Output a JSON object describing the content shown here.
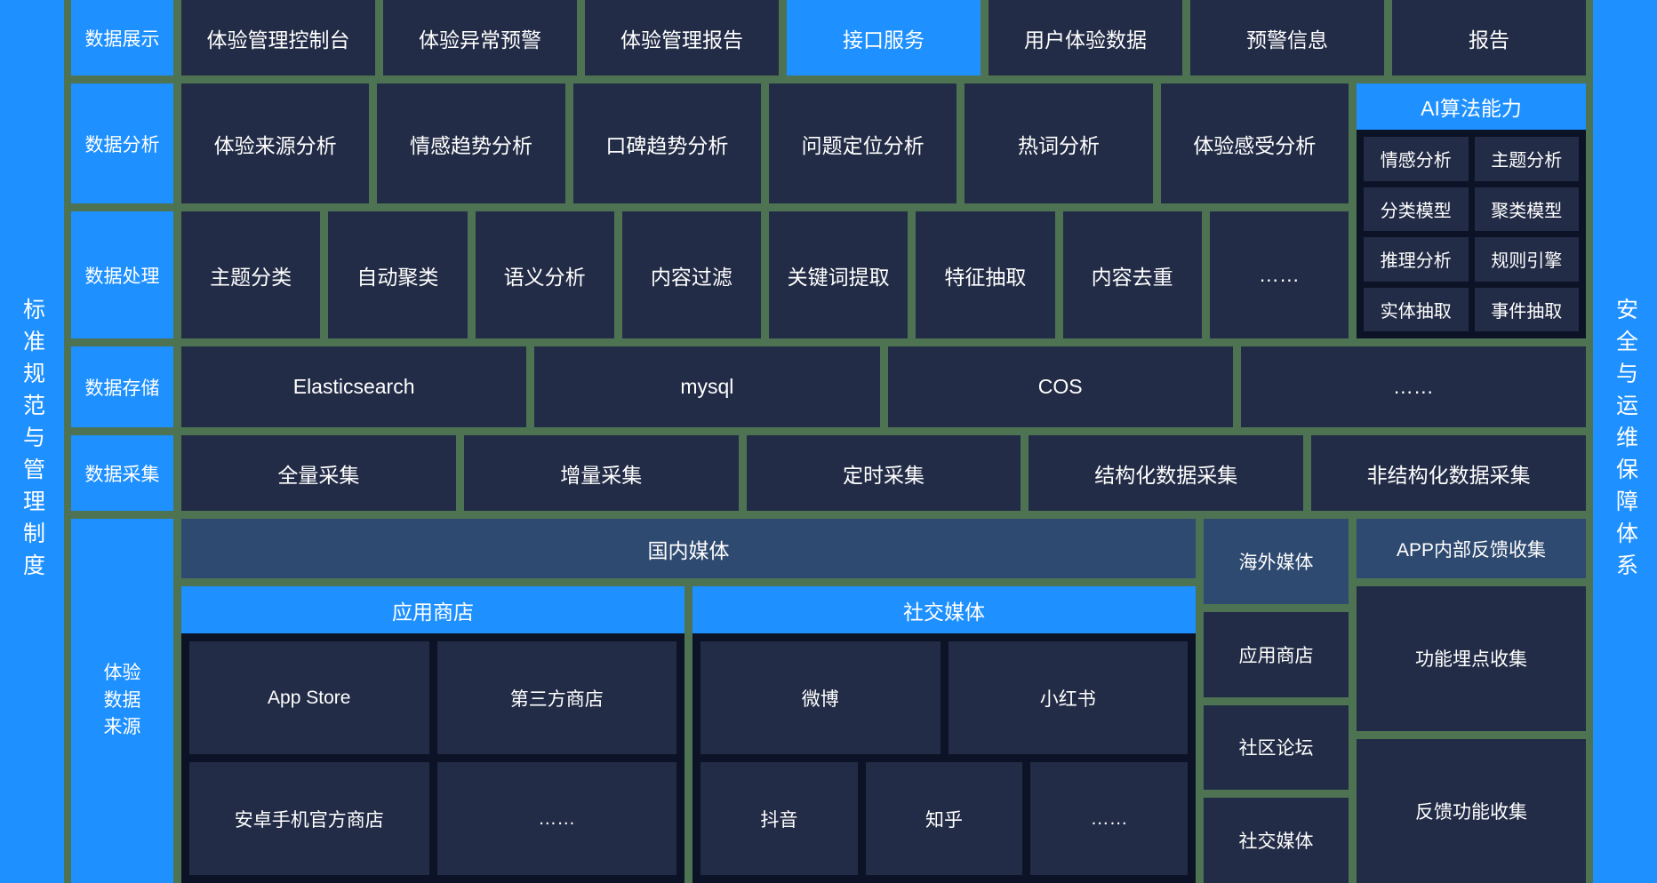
{
  "left_pillar": {
    "label": "标准规范与管理制度"
  },
  "right_pillar": {
    "label": "安全与运维保障体系"
  },
  "rows": {
    "display": {
      "label": "数据展示",
      "items": [
        {
          "text": "体验管理控制台",
          "style": "dark"
        },
        {
          "text": "体验异常预警",
          "style": "dark"
        },
        {
          "text": "体验管理报告",
          "style": "dark"
        },
        {
          "text": "接口服务",
          "style": "blue"
        },
        {
          "text": "用户体验数据",
          "style": "dark"
        },
        {
          "text": "预警信息",
          "style": "dark"
        },
        {
          "text": "报告",
          "style": "dark"
        }
      ]
    },
    "analysis": {
      "label": "数据分析",
      "items": [
        {
          "text": "体验来源分析"
        },
        {
          "text": "情感趋势分析"
        },
        {
          "text": "口碑趋势分析"
        },
        {
          "text": "问题定位分析"
        },
        {
          "text": "热词分析"
        },
        {
          "text": "体验感受分析"
        }
      ]
    },
    "process": {
      "label": "数据处理",
      "items": [
        {
          "text": "主题分类"
        },
        {
          "text": "自动聚类"
        },
        {
          "text": "语义分析"
        },
        {
          "text": "内容过滤"
        },
        {
          "text": "关键词提取"
        },
        {
          "text": "特征抽取"
        },
        {
          "text": "内容去重"
        },
        {
          "text": "……"
        }
      ]
    },
    "storage": {
      "label": "数据存储",
      "items": [
        {
          "text": "Elasticsearch"
        },
        {
          "text": "mysql"
        },
        {
          "text": "COS"
        },
        {
          "text": "……"
        }
      ]
    },
    "collect": {
      "label": "数据采集",
      "items": [
        {
          "text": "全量采集"
        },
        {
          "text": "增量采集"
        },
        {
          "text": "定时采集"
        },
        {
          "text": "结构化数据采集"
        },
        {
          "text": "非结构化数据采集"
        }
      ]
    },
    "source": {
      "label_lines": [
        "体验",
        "数据",
        "来源"
      ],
      "domestic_media": "国内媒体",
      "app_store_group": {
        "title": "应用商店",
        "rows": [
          [
            "App Store",
            "第三方商店"
          ],
          [
            "安卓手机官方商店",
            "……"
          ]
        ]
      },
      "social_group": {
        "title": "社交媒体",
        "rows": [
          [
            "微博",
            "小红书"
          ],
          [
            "抖音",
            "知乎",
            "……"
          ]
        ]
      },
      "column_a": [
        {
          "text": "海外媒体",
          "style": "steel"
        },
        {
          "text": "应用商店",
          "style": "dark"
        },
        {
          "text": "社区论坛",
          "style": "dark"
        },
        {
          "text": "社交媒体",
          "style": "dark"
        }
      ],
      "column_b": [
        {
          "text": "APP内部反馈收集",
          "style": "steel"
        },
        {
          "text": "功能埋点收集",
          "style": "dark"
        },
        {
          "text": "反馈功能收集",
          "style": "dark"
        }
      ]
    }
  },
  "ai_panel": {
    "title": "AI算法能力",
    "cells": [
      "情感分析",
      "主题分析",
      "分类模型",
      "聚类模型",
      "推理分析",
      "规则引擎",
      "实体抽取",
      "事件抽取"
    ]
  },
  "colors": {
    "background_green": "#4d7352",
    "card_dark": "#232c46",
    "accent_blue": "#1e90ff",
    "steel_blue": "#2f4a70",
    "panel_black": "#0d1326"
  }
}
